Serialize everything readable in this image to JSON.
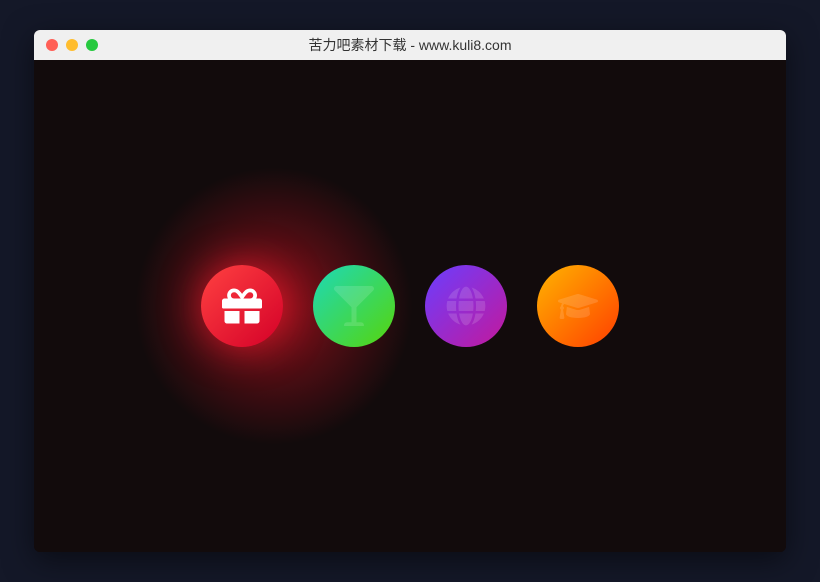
{
  "window": {
    "title": "苦力吧素材下载 - www.kuli8.com"
  },
  "trafficLights": {
    "close": "close",
    "minimize": "minimize",
    "maximize": "maximize"
  },
  "icons": [
    {
      "name": "gift-icon",
      "active": true
    },
    {
      "name": "cocktail-icon",
      "active": false
    },
    {
      "name": "globe-icon",
      "active": false
    },
    {
      "name": "graduation-cap-icon",
      "active": false
    }
  ]
}
